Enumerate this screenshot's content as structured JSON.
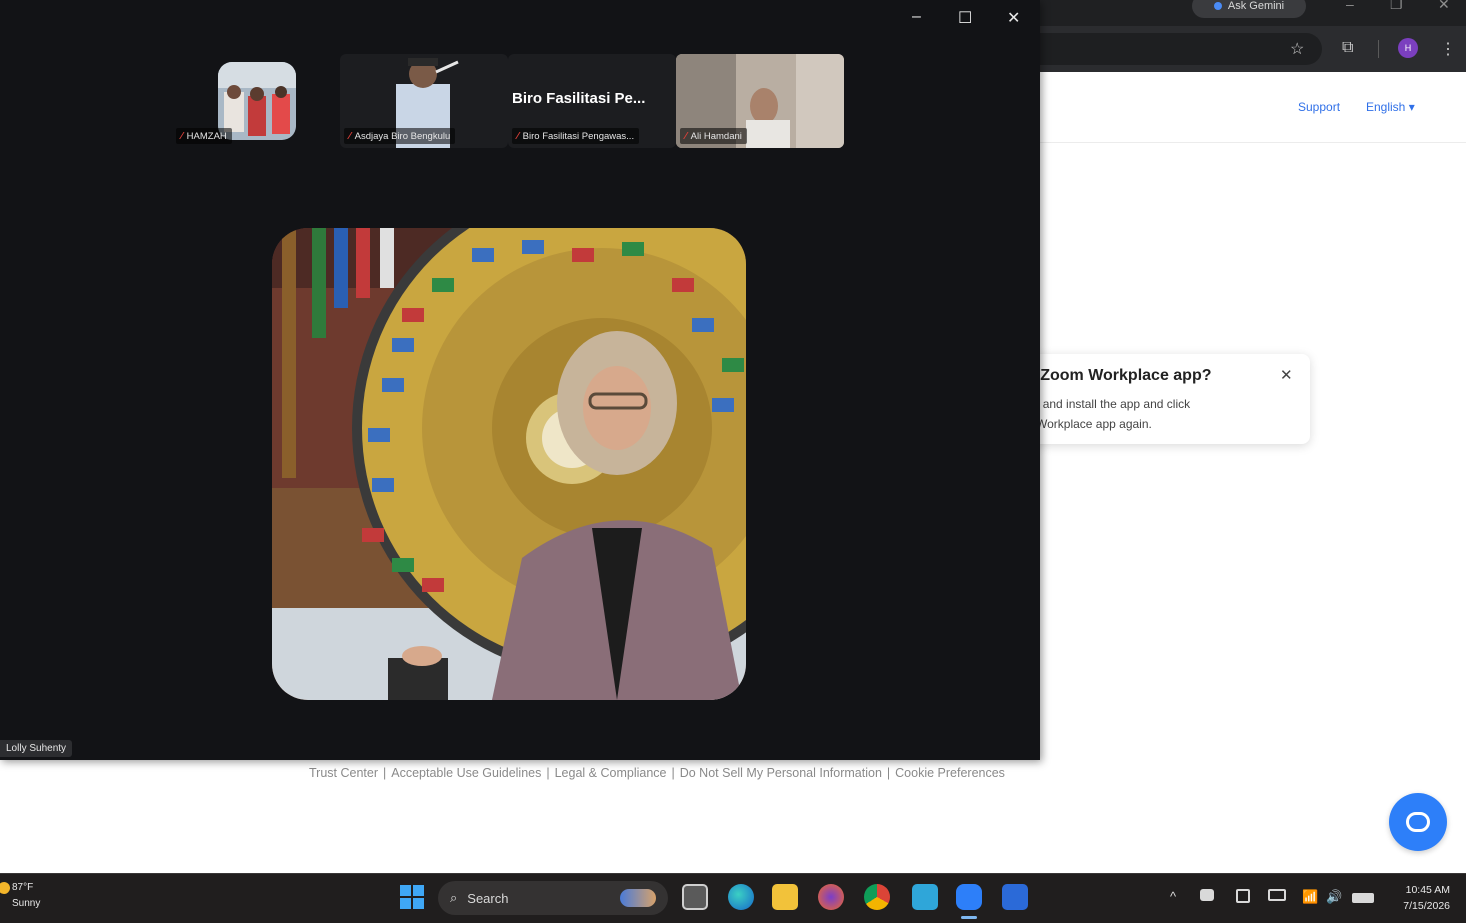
{
  "browser": {
    "gemini_label": "Ask Gemini",
    "minimize_glyph": "–",
    "restore_glyph": "❐",
    "close_glyph": "✕",
    "star_icon": "☆",
    "extensions_icon": "⧉",
    "profile_initial": "H",
    "menu_icon": "⋮",
    "support_label": "Support",
    "language_label": "English ▾"
  },
  "open_dialog": {
    "title": "n Zoom Workplace app?",
    "line1_link": "ad",
    "line1_rest": " and install the app and click",
    "line2": "n Workplace app again.",
    "close_glyph": "✕"
  },
  "footer": {
    "links": [
      "Trust Center",
      "Acceptable Use Guidelines",
      "Legal & Compliance",
      "Do Not Sell My Personal Information",
      "Cookie Preferences"
    ],
    "separator": "|"
  },
  "zoom": {
    "minimize_glyph": "–",
    "restore_glyph": "☐",
    "close_glyph": "✕",
    "participants": [
      {
        "name": "HAMZAH"
      },
      {
        "name": "Asdjaya Biro Bengkulu"
      },
      {
        "name": "Biro Fasilitasi Pengawas..."
      },
      {
        "name": "Ali Hamdani"
      }
    ],
    "large_name": "Biro Fasilitasi Pe...",
    "active_speaker": "Lolly Suhenty",
    "mic_off_icon": "🎙"
  },
  "taskbar": {
    "weather_temp": "87°F",
    "weather_desc": "Sunny",
    "search_placeholder": "Search",
    "search_icon": "⌕",
    "time": "10:45 AM",
    "date": "7/15/2026",
    "tray": {
      "chevron": "^",
      "wifi": "📶",
      "volume": "🔊",
      "battery": "▭"
    },
    "colors": {
      "accent": "#3fa7f5",
      "zoom_blue": "#2d7ff9"
    }
  }
}
